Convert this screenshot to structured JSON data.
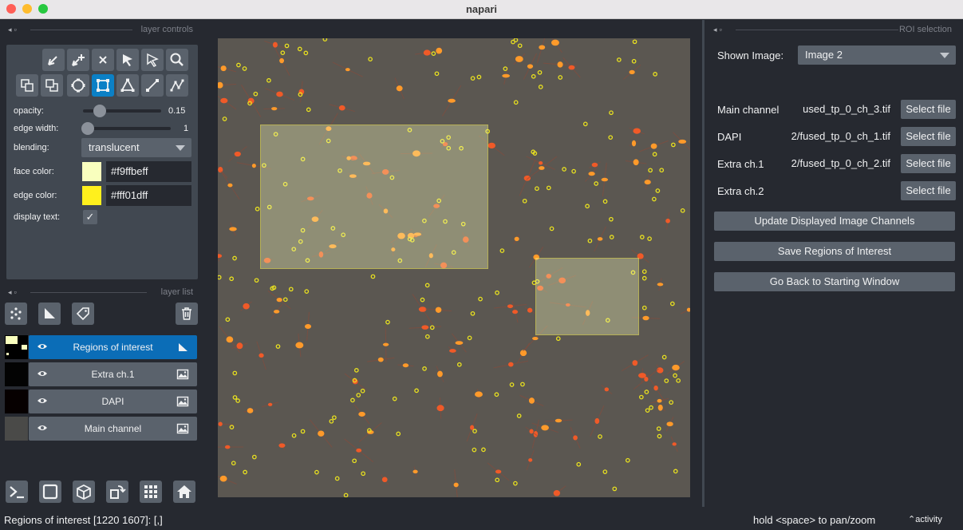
{
  "window": {
    "title": "napari",
    "traffic_lights": [
      "#ff5f57",
      "#febc2e",
      "#28c840"
    ]
  },
  "left_dock": {
    "controls_header": "layer controls",
    "layer_list_header": "layer list",
    "opacity": {
      "label": "opacity:",
      "value": "0.15",
      "fraction": 0.15
    },
    "edge_width": {
      "label": "edge width:",
      "value": "1",
      "fraction": 0.0
    },
    "blending": {
      "label": "blending:",
      "value": "translucent"
    },
    "face_color": {
      "label": "face color:",
      "value": "#f9ffbeff",
      "swatch": "#f9ffbe"
    },
    "edge_color": {
      "label": "edge color:",
      "value": "#fff01dff",
      "swatch": "#fff01d"
    },
    "display_text": {
      "label": "display text:",
      "checked": true,
      "mark": "✓"
    },
    "layers": [
      {
        "name": "Regions of interest",
        "type_icon": "shapes-icon",
        "selected": true
      },
      {
        "name": "Extra ch.1",
        "type_icon": "image-icon",
        "selected": false
      },
      {
        "name": "DAPI",
        "type_icon": "image-icon",
        "selected": false
      },
      {
        "name": "Main channel",
        "type_icon": "image-icon",
        "selected": false
      }
    ]
  },
  "right_dock": {
    "header": "ROI selection",
    "shown_image_label": "Shown Image:",
    "shown_image_value": "Image 2",
    "channels": [
      {
        "label": "Main channel",
        "value": "used_tp_0_ch_3.tif",
        "button": "Select file"
      },
      {
        "label": "DAPI",
        "value": "2/fused_tp_0_ch_1.tif",
        "button": "Select file"
      },
      {
        "label": "Extra ch.1",
        "value": "2/fused_tp_0_ch_2.tif",
        "button": "Select file"
      },
      {
        "label": "Extra ch.2",
        "value": "",
        "button": "Select file"
      }
    ],
    "update_button": "Update Displayed Image Channels",
    "save_button": "Save Regions of Interest",
    "back_button": "Go Back to Starting Window"
  },
  "status_bar": {
    "left": "Regions of interest [1220 1607]: [,]",
    "hint": "hold <space> to pan/zoom",
    "activity": "activity"
  },
  "colors": {
    "background": "#262930",
    "panel": "#414851",
    "button": "#5a626c",
    "accent": "#0b80c6",
    "image_bg": "#5b5751"
  }
}
